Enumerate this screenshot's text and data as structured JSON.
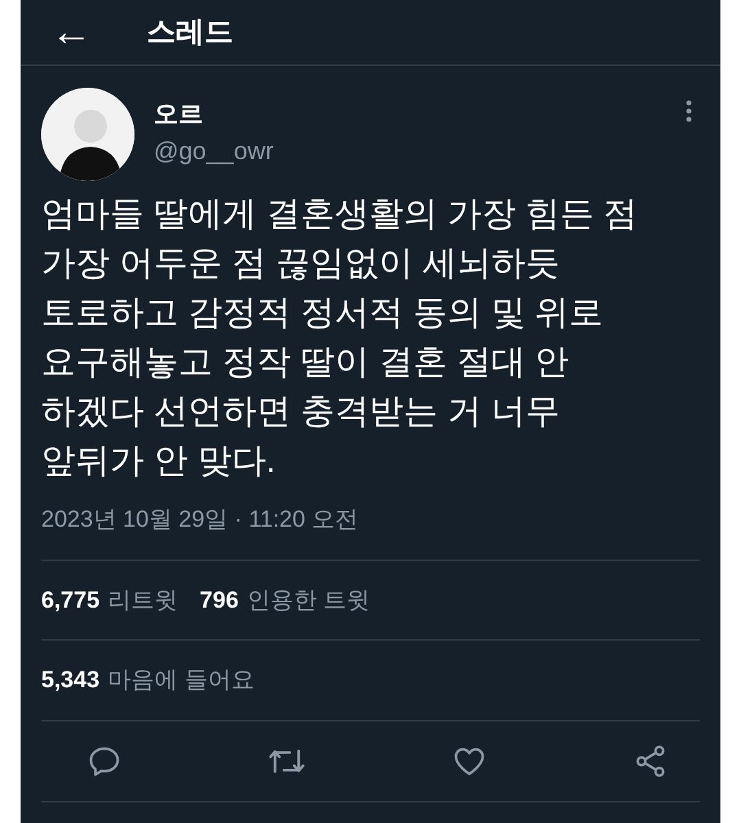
{
  "header": {
    "back": "←",
    "title": "스레드"
  },
  "author": {
    "name": "오르",
    "handle": "@go__owr"
  },
  "text": "엄마들 딸에게 결혼생활의 가장 힘든 점 가장 어두운 점 끊임없이 세뇌하듯 토로하고 감정적 정서적 동의 및 위로 요구해놓고 정작 딸이 결혼 절대 안 하겠다 선언하면 충격받는 거 너무 앞뒤가 안 맞다.",
  "timestamp": "2023년 10월 29일 · 11:20 오전",
  "stat_rows": [
    [
      {
        "count": "6,775",
        "label": "리트윗"
      },
      {
        "count": "796",
        "label": "인용한 트윗"
      }
    ],
    [
      {
        "count": "5,343",
        "label": "마음에 들어요"
      }
    ]
  ]
}
